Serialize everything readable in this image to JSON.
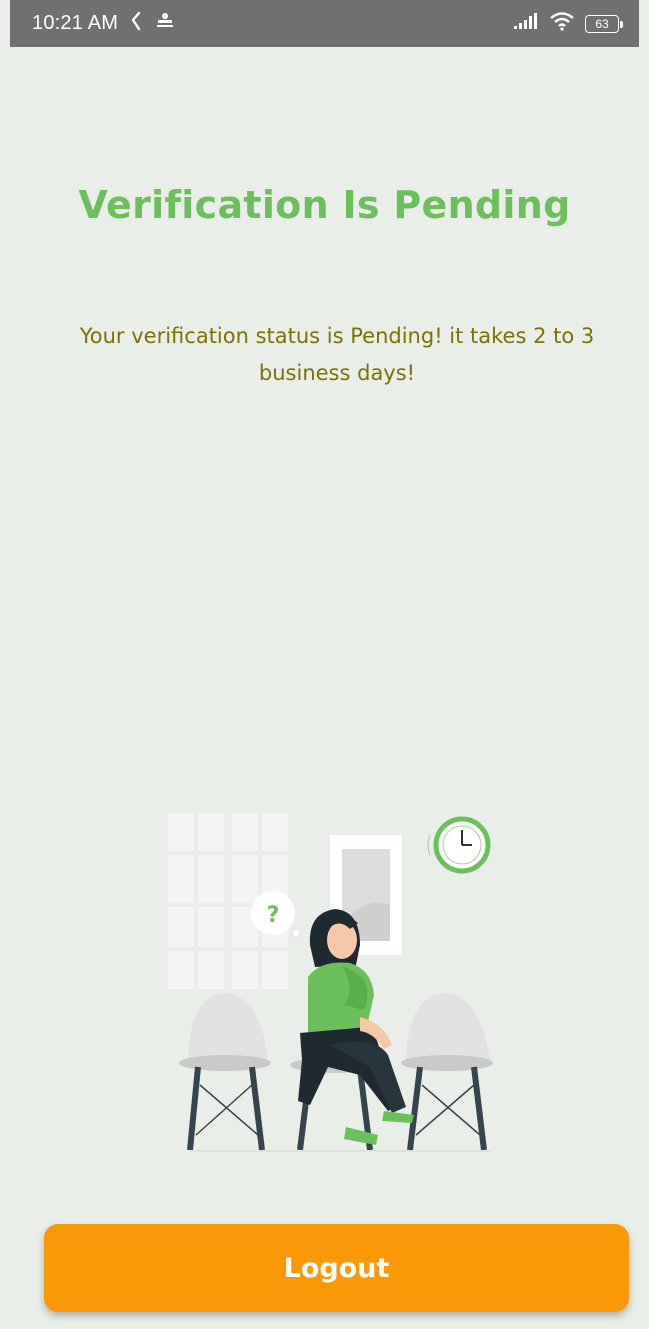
{
  "status_bar": {
    "time": "10:21 AM",
    "battery": "63"
  },
  "main": {
    "title": "Verification Is Pending",
    "message": "Your verification status is Pending! it takes 2 to 3 business days!"
  },
  "illustration": {
    "question_mark": "?"
  },
  "actions": {
    "logout_label": "Logout"
  },
  "colors": {
    "background": "#e9eee9",
    "title": "#6cbf5c",
    "message": "#7c7200",
    "button": "#fb9806",
    "status_bar": "#707070"
  },
  "icons": {
    "status_left": [
      "notification-app-icon",
      "notification-badge-icon"
    ],
    "status_right": [
      "signal-icon",
      "wifi-icon",
      "battery-icon"
    ]
  }
}
